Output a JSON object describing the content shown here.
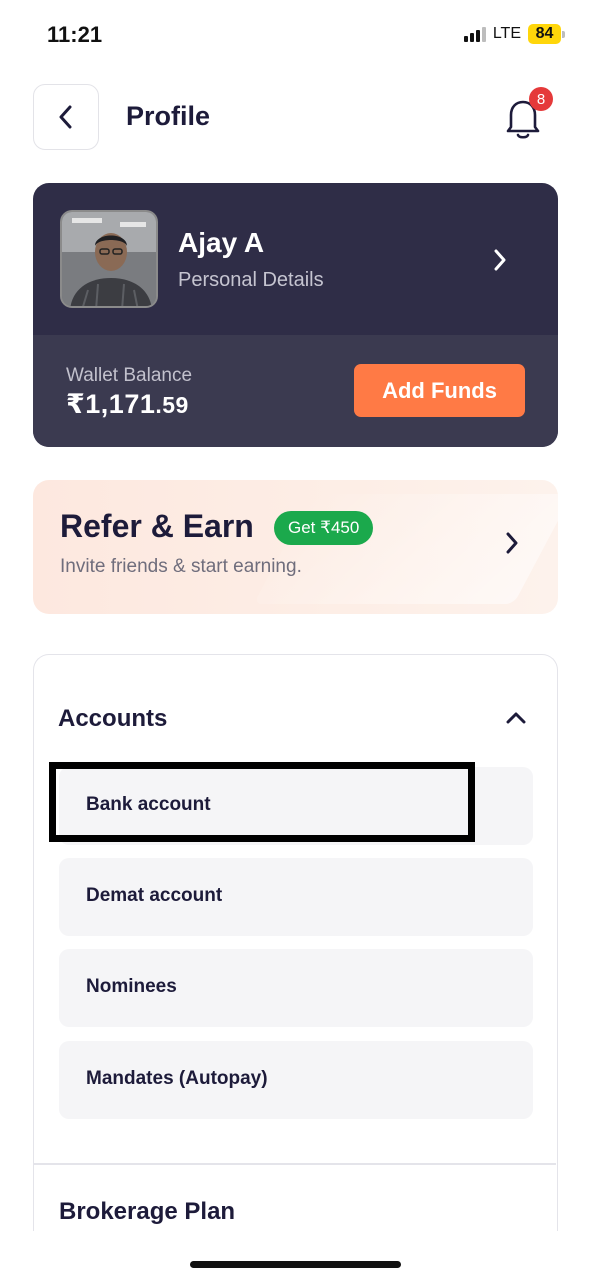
{
  "status_bar": {
    "time": "11:21",
    "network": "LTE",
    "battery": "84"
  },
  "header": {
    "title": "Profile",
    "notification_count": "8",
    "back_icon": "chevron-left-icon",
    "bell_icon": "bell-icon"
  },
  "profile": {
    "name": "Ajay A",
    "subtitle": "Personal Details",
    "wallet_label": "Wallet Balance",
    "wallet_value_main": "₹1,171",
    "wallet_value_decimal": ".59",
    "add_funds_label": "Add Funds"
  },
  "refer": {
    "title": "Refer & Earn",
    "badge": "Get ₹450",
    "subtitle": "Invite friends & start earning."
  },
  "accounts": {
    "title": "Accounts",
    "items": [
      {
        "label": "Bank account"
      },
      {
        "label": "Demat account"
      },
      {
        "label": "Nominees"
      },
      {
        "label": "Mandates (Autopay)"
      }
    ],
    "next_section_title": "Brokerage Plan"
  },
  "colors": {
    "card_dark": "#2f2d47",
    "card_dark_bottom": "#3b3a50",
    "accent_orange": "#ff7a45",
    "badge_green": "#1ba94c",
    "badge_red": "#e5393a",
    "refer_bg": "#fde8df"
  }
}
